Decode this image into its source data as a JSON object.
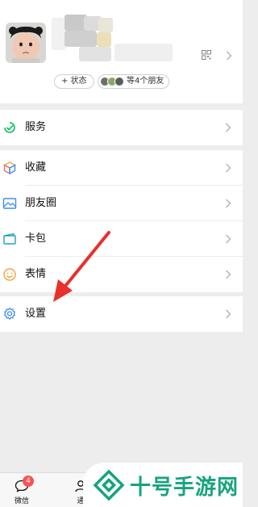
{
  "profile": {
    "status_label": "+ 状态",
    "friends_label": "等4个朋友"
  },
  "menu": {
    "services": "服务",
    "favorites": "收藏",
    "moments": "朋友圈",
    "cards": "卡包",
    "stickers": "表情",
    "settings": "设置"
  },
  "tabbar": {
    "chats_label": "微信",
    "chats_badge": "4",
    "contacts_label": "通"
  },
  "watermark": {
    "text": "十号手游网"
  },
  "colors": {
    "accent_green": "#07c160",
    "watermark_green": "#16a37f",
    "badge_red": "#fa5151",
    "arrow_red": "#e8302c"
  }
}
